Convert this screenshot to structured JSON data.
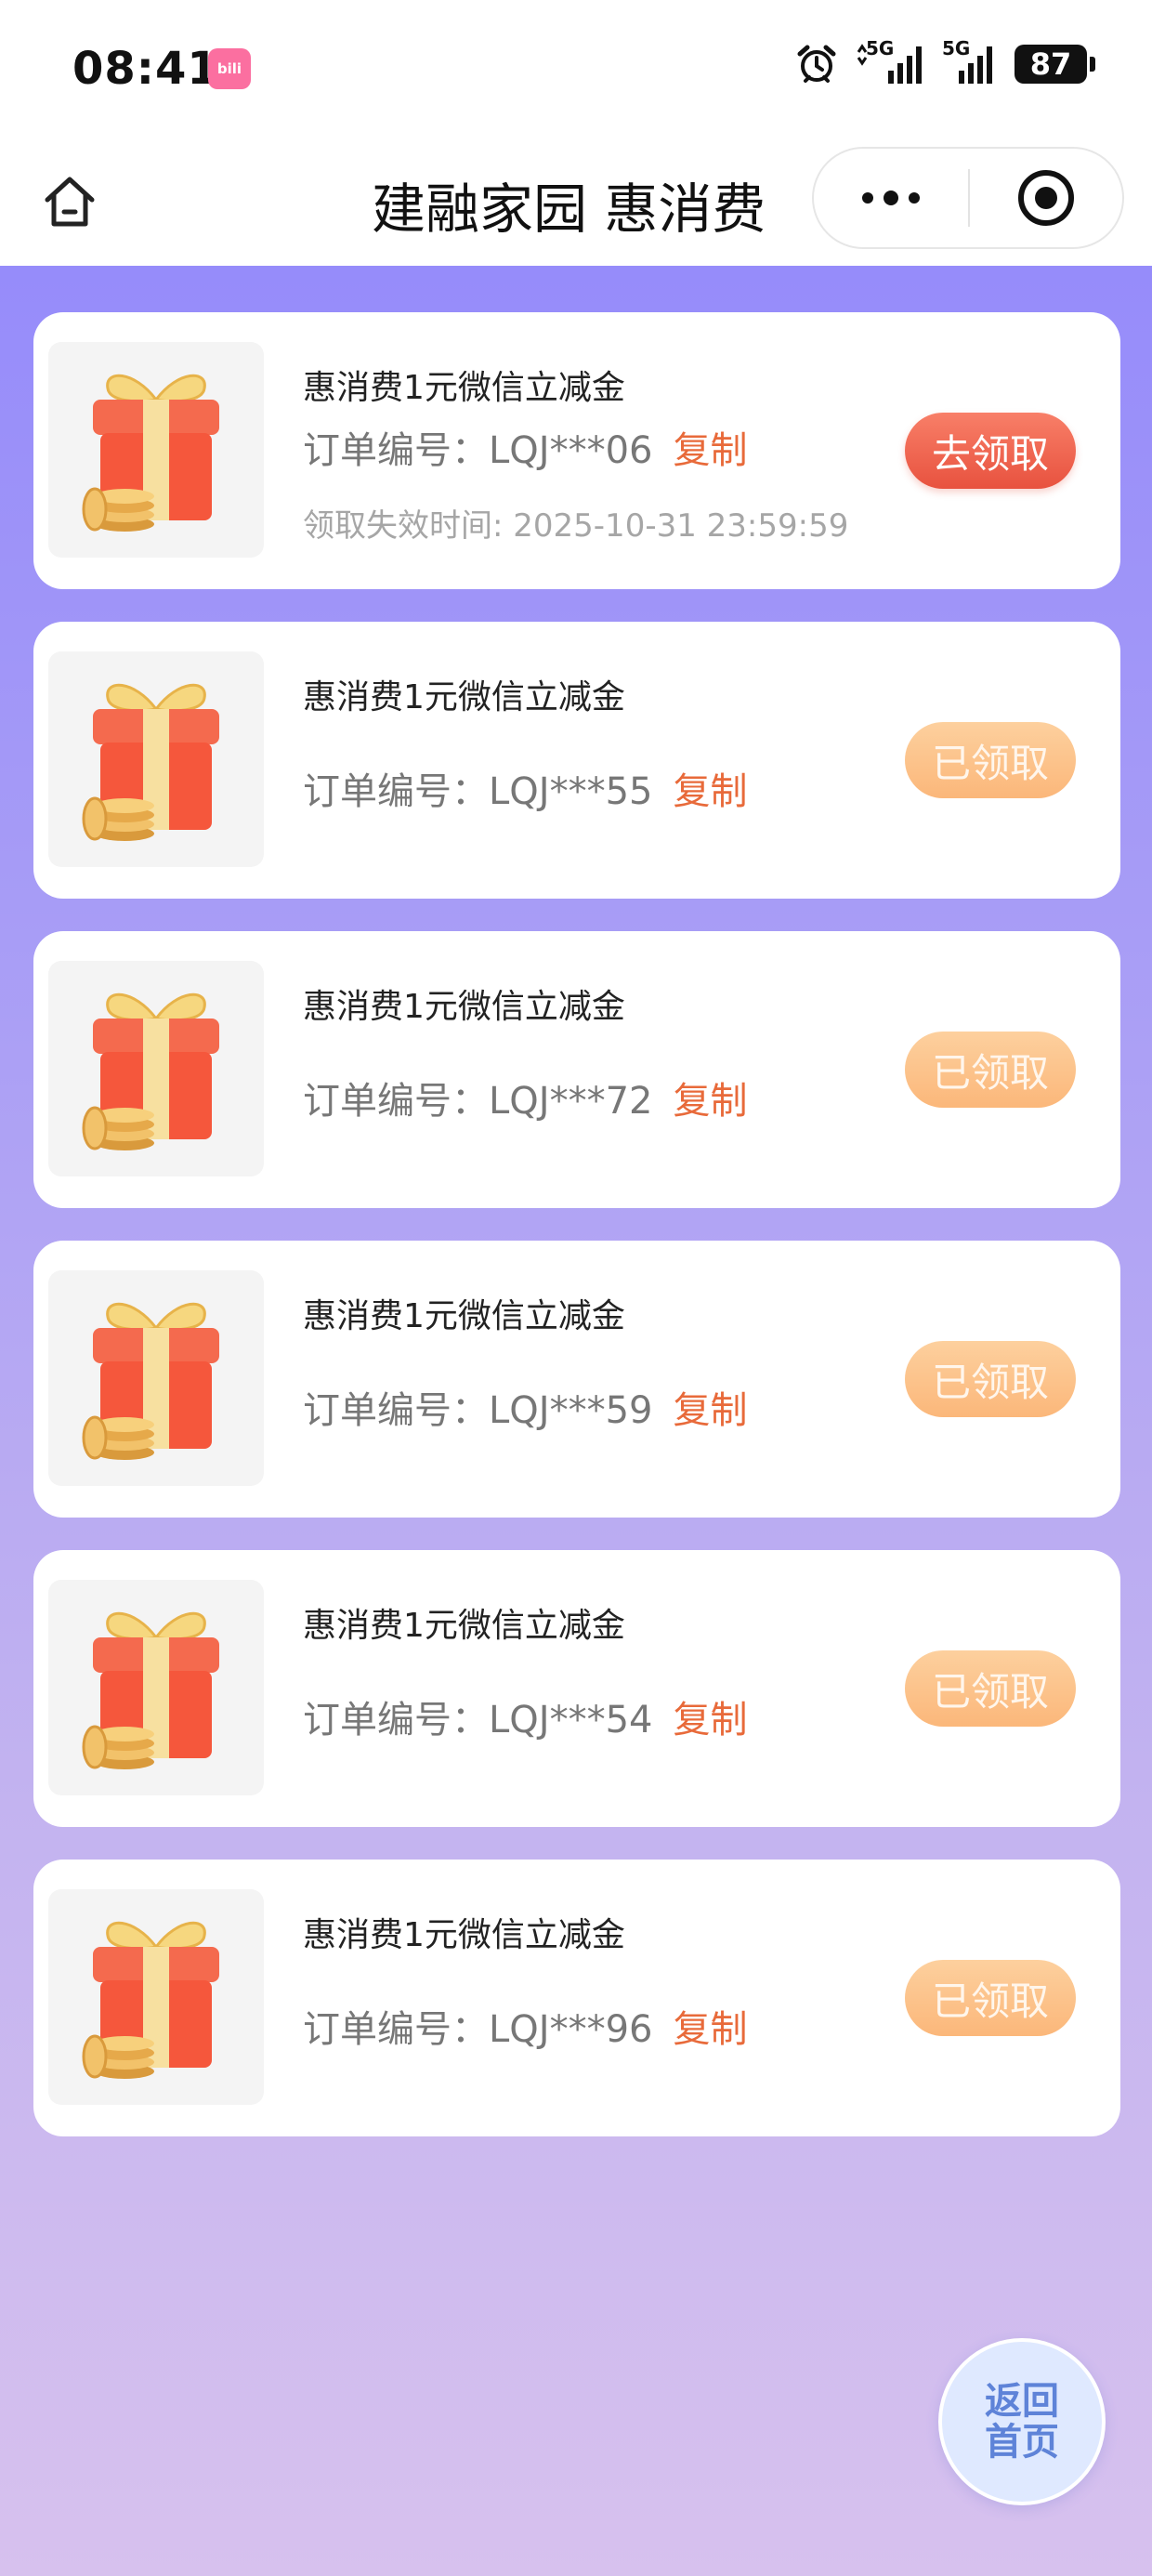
{
  "status_bar": {
    "time": "08:41",
    "app_badge": "bili",
    "network_1": "5G",
    "network_2": "5G",
    "battery": "87"
  },
  "nav": {
    "title": "建融家园 惠消费"
  },
  "coupons": [
    {
      "title": "惠消费1元微信立减金",
      "order_label": "订单编号：",
      "order_no": "LQJ***06",
      "copy_label": "复制",
      "expiry": "领取失效时间: 2025-10-31 23:59:59",
      "button": "去领取",
      "state": "active"
    },
    {
      "title": "惠消费1元微信立减金",
      "order_label": "订单编号：",
      "order_no": "LQJ***55",
      "copy_label": "复制",
      "button": "已领取",
      "state": "done"
    },
    {
      "title": "惠消费1元微信立减金",
      "order_label": "订单编号：",
      "order_no": "LQJ***72",
      "copy_label": "复制",
      "button": "已领取",
      "state": "done"
    },
    {
      "title": "惠消费1元微信立减金",
      "order_label": "订单编号：",
      "order_no": "LQJ***59",
      "copy_label": "复制",
      "button": "已领取",
      "state": "done"
    },
    {
      "title": "惠消费1元微信立减金",
      "order_label": "订单编号：",
      "order_no": "LQJ***54",
      "copy_label": "复制",
      "button": "已领取",
      "state": "done"
    },
    {
      "title": "惠消费1元微信立减金",
      "order_label": "订单编号：",
      "order_no": "LQJ***96",
      "copy_label": "复制",
      "button": "已领取",
      "state": "done"
    }
  ],
  "back_home": {
    "line1": "返回",
    "line2": "首页"
  },
  "colors": {
    "accent_active": "#e8523f",
    "accent_done": "#fbb77a",
    "copy_link": "#e86a3a",
    "background_top": "#8f85fc",
    "background_bottom": "#d7c1ee"
  },
  "icons": {
    "home": "home-icon",
    "more": "more-dots-icon",
    "close": "target-close-icon",
    "gift": "gift-box-icon",
    "alarm": "alarm-clock-icon",
    "signal": "signal-icon"
  }
}
